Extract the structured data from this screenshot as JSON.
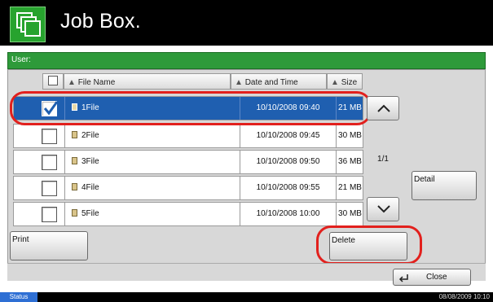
{
  "header": {
    "title": "Job Box.",
    "icon": "job-box-icon"
  },
  "user": {
    "label": "User:"
  },
  "columns": [
    {
      "label": "File Name",
      "sort_icon": "sort-arrow-icon"
    },
    {
      "label": "Date and Time",
      "sort_icon": "sort-arrow-icon"
    },
    {
      "label": "Size",
      "sort_icon": "sort-arrow-icon"
    }
  ],
  "files": [
    {
      "name": "1File",
      "datetime": "10/10/2008 09:40",
      "size": "21 MB",
      "checked": true,
      "selected": true
    },
    {
      "name": "2File",
      "datetime": "10/10/2008 09:45",
      "size": "30 MB",
      "checked": false,
      "selected": false
    },
    {
      "name": "3File",
      "datetime": "10/10/2008 09:50",
      "size": "36 MB",
      "checked": false,
      "selected": false
    },
    {
      "name": "4File",
      "datetime": "10/10/2008 09:55",
      "size": "21 MB",
      "checked": false,
      "selected": false
    },
    {
      "name": "5File",
      "datetime": "10/10/2008 10:00",
      "size": "30 MB",
      "checked": false,
      "selected": false
    }
  ],
  "pager": {
    "page": "1/1"
  },
  "buttons": {
    "detail": "Detail",
    "print": "Print",
    "delete": "Delete",
    "close": "Close"
  },
  "status": {
    "label": "Status",
    "datetime": "08/08/2009   10:10"
  },
  "colors": {
    "accent_green": "#2e9a3a",
    "selection_blue": "#1f5fb0",
    "highlight_red": "#e2201d"
  }
}
